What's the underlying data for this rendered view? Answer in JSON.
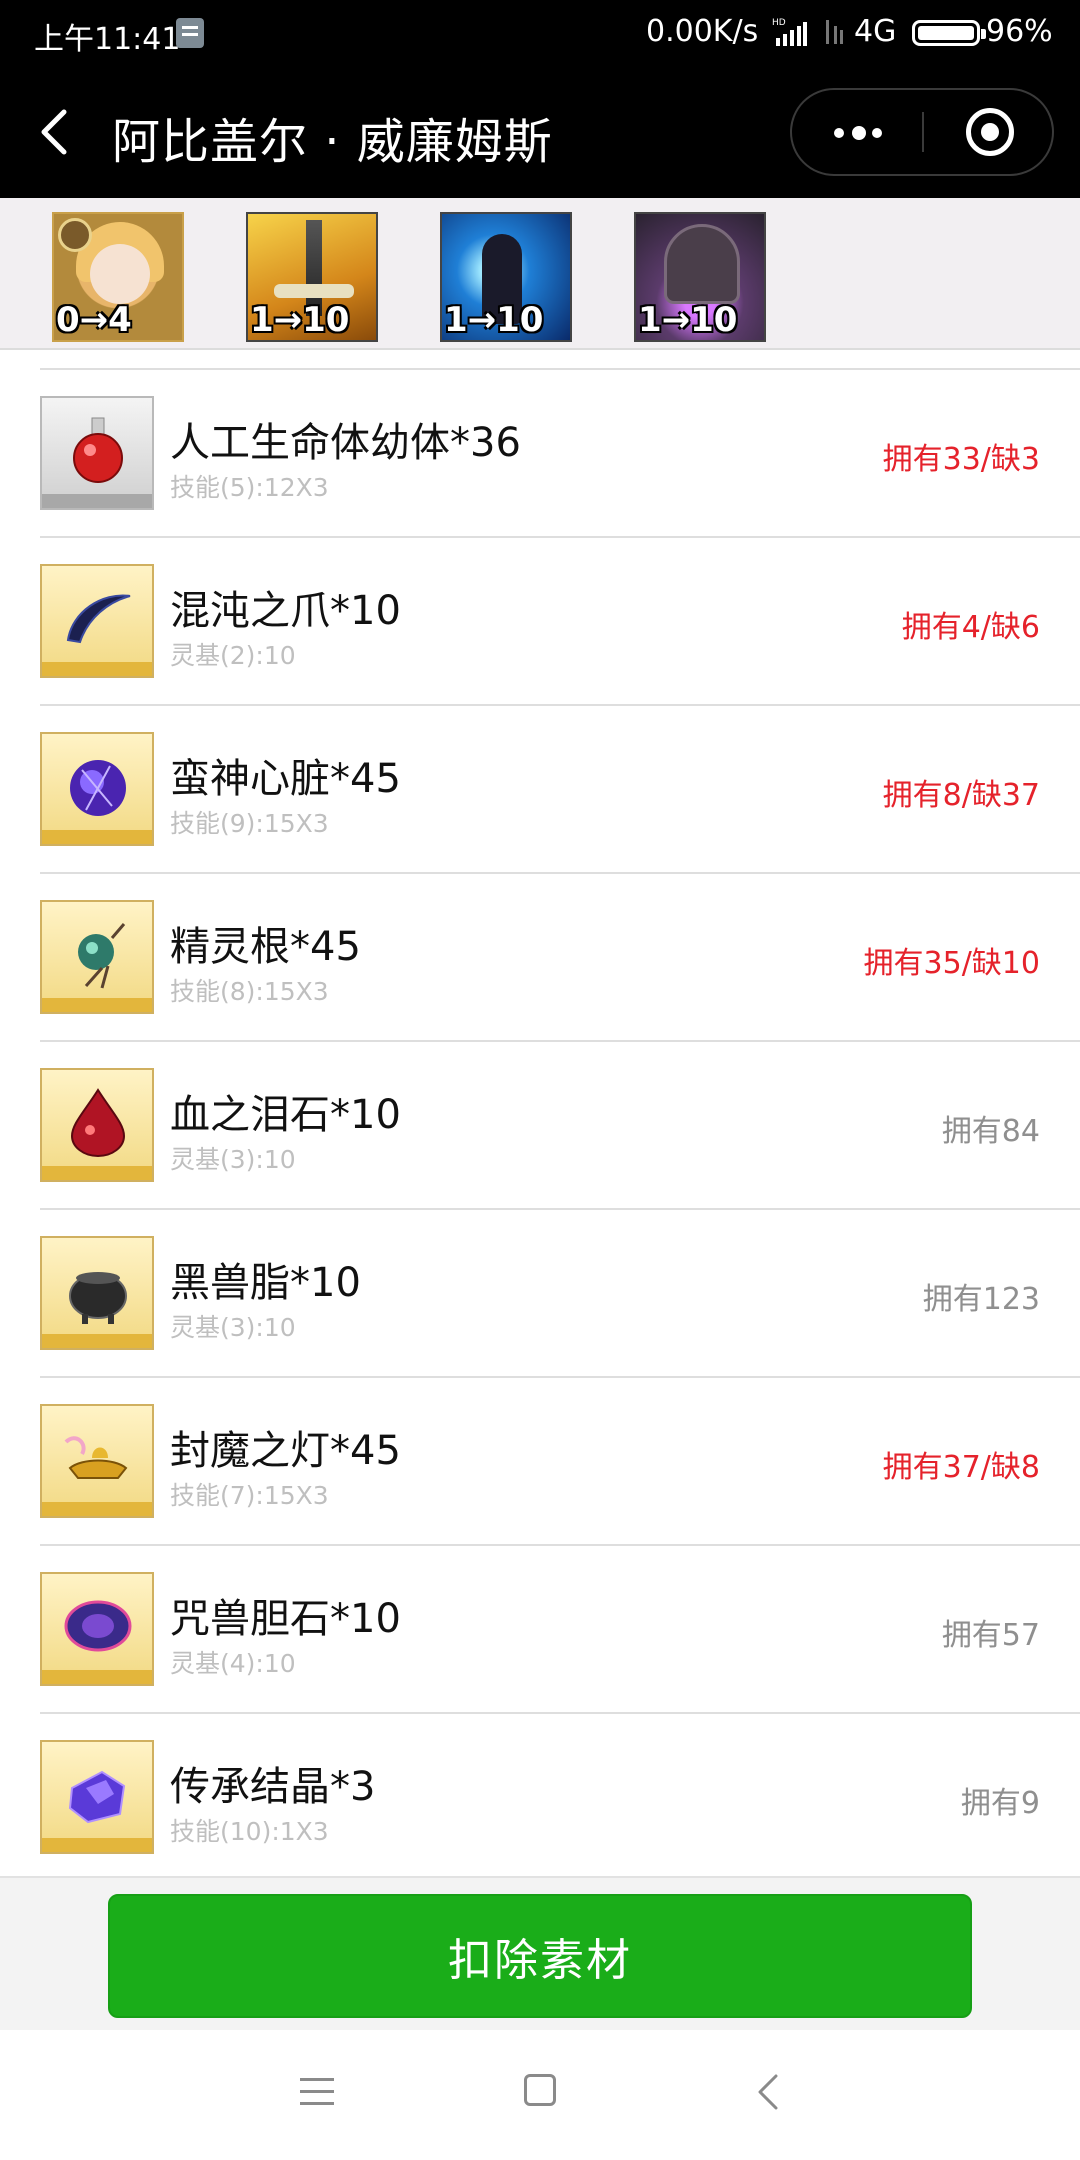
{
  "status_bar": {
    "time": "上午11:41",
    "net_speed": "0.00K/s",
    "network": "4G",
    "battery": "96%"
  },
  "nav": {
    "title": "阿比盖尔 · 威廉姆斯",
    "back_icon": "chevron-left-icon",
    "more_icon": "more-dots-icon",
    "close_icon": "target-close-icon"
  },
  "header_icons": [
    {
      "name": "servant-portrait",
      "level": "0→4"
    },
    {
      "name": "skill-1-sword",
      "level": "1→10"
    },
    {
      "name": "skill-2-lightning",
      "level": "1→10"
    },
    {
      "name": "skill-3-hooded",
      "level": "1→10"
    }
  ],
  "materials": [
    {
      "name": "人工生命体幼体*36",
      "detail": "技能(5):12X3",
      "status": "拥有33/缺3",
      "short": true,
      "icon": "homunculus-flask-icon"
    },
    {
      "name": "混沌之爪*10",
      "detail": "灵基(2):10",
      "status": "拥有4/缺6",
      "short": true,
      "icon": "chaos-claw-icon"
    },
    {
      "name": "蛮神心脏*45",
      "detail": "技能(9):15X3",
      "status": "拥有8/缺37",
      "short": true,
      "icon": "heart-of-foreign-god-icon"
    },
    {
      "name": "精灵根*45",
      "detail": "技能(8):15X3",
      "status": "拥有35/缺10",
      "short": true,
      "icon": "spirit-root-icon"
    },
    {
      "name": "血之泪石*10",
      "detail": "灵基(3):10",
      "status": "拥有84",
      "short": false,
      "icon": "blood-tear-stone-icon"
    },
    {
      "name": "黑兽脂*10",
      "detail": "灵基(3):10",
      "status": "拥有123",
      "short": false,
      "icon": "black-beast-grease-icon"
    },
    {
      "name": "封魔之灯*45",
      "detail": "技能(7):15X3",
      "status": "拥有37/缺8",
      "short": true,
      "icon": "magic-lamp-icon"
    },
    {
      "name": "咒兽胆石*10",
      "detail": "灵基(4):10",
      "status": "拥有57",
      "short": false,
      "icon": "cursed-beast-gallstone-icon"
    },
    {
      "name": "传承结晶*3",
      "detail": "技能(10):1X3",
      "status": "拥有9",
      "short": false,
      "icon": "crystal-of-lore-icon"
    }
  ],
  "footer": {
    "deduct_label": "扣除素材"
  },
  "colors": {
    "short": "#e5222b",
    "ok": "#8f8f8f",
    "button": "#1aad19"
  }
}
